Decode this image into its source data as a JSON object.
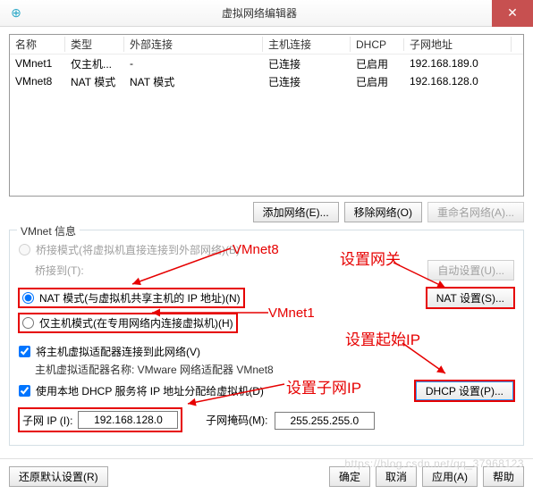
{
  "title": "虚拟网络编辑器",
  "close_glyph": "✕",
  "app_icon_glyph": "⊕",
  "table": {
    "headers": {
      "name": "名称",
      "type": "类型",
      "ext": "外部连接",
      "host": "主机连接",
      "dhcp": "DHCP",
      "subnet": "子网地址"
    },
    "rows": [
      {
        "name": "VMnet1",
        "type": "仅主机...",
        "ext": "-",
        "host": "已连接",
        "dhcp": "已启用",
        "subnet": "192.168.189.0"
      },
      {
        "name": "VMnet8",
        "type": "NAT 模式",
        "ext": "NAT 模式",
        "host": "已连接",
        "dhcp": "已启用",
        "subnet": "192.168.128.0"
      }
    ]
  },
  "buttons": {
    "add_net": "添加网络(E)...",
    "remove_net": "移除网络(O)",
    "rename_net": "重命名网络(A)...",
    "auto_set": "自动设置(U)...",
    "nat_set": "NAT 设置(S)...",
    "dhcp_set": "DHCP 设置(P)...",
    "restore": "还原默认设置(R)",
    "ok": "确定",
    "cancel": "取消",
    "apply": "应用(A)",
    "help": "帮助"
  },
  "group": {
    "title": "VMnet 信息",
    "bridged": "桥接模式(将虚拟机直接连接到外部网络)(B)",
    "bridged_to": "桥接到(T):",
    "nat": "NAT 模式(与虚拟机共享主机的 IP 地址)(N)",
    "hostonly": "仅主机模式(在专用网络内连接虚拟机)(H)",
    "connect_host": "将主机虚拟适配器连接到此网络(V)",
    "adapter_name": "主机虚拟适配器名称: VMware 网络适配器 VMnet8",
    "use_dhcp": "使用本地 DHCP 服务将 IP 地址分配给虚拟机(D)",
    "subnet_ip": "子网 IP (I):",
    "subnet_ip_val": "192.168.128.0",
    "mask": "子网掩码(M):",
    "mask_val": "255.255.255.0"
  },
  "annotations": {
    "vmnet8": "VMnet8",
    "vmnet1": "VMnet1",
    "gateway": "设置网关",
    "start_ip": "设置起始IP",
    "subnet": "设置子网IP"
  },
  "watermark": "https://blog.csdn.net/qq_37968123"
}
